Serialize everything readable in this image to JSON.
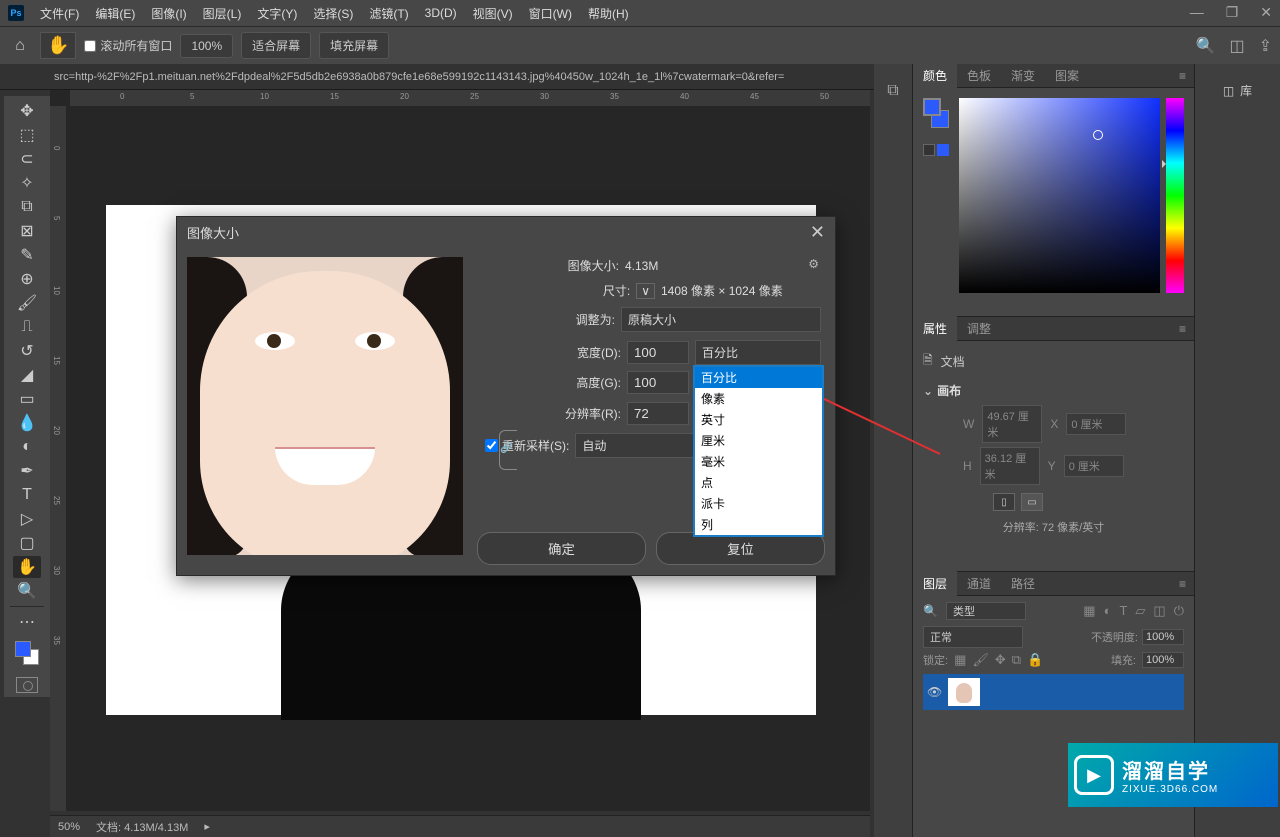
{
  "menu": {
    "items": [
      "文件(F)",
      "编辑(E)",
      "图像(I)",
      "图层(L)",
      "文字(Y)",
      "选择(S)",
      "滤镜(T)",
      "3D(D)",
      "视图(V)",
      "窗口(W)",
      "帮助(H)"
    ]
  },
  "options": {
    "scroll_all": "滚动所有窗口",
    "zoom": "100%",
    "fit_screen": "适合屏幕",
    "fill_screen": "填充屏幕"
  },
  "doc_tab": "src=http-%2F%2Fp1.meituan.net%2Fdpdeal%2F5d5db2e6938a0b879cfe1e68e599192c1143143.jpg%40450w_1024h_1e_1l%7cwatermark=0&refer=",
  "ruler_h": [
    "0",
    "5",
    "10",
    "15",
    "20",
    "25",
    "30",
    "35",
    "40",
    "45",
    "50"
  ],
  "ruler_v": [
    "0",
    "5",
    "10",
    "15",
    "20",
    "25",
    "30",
    "35"
  ],
  "dialog": {
    "title": "图像大小",
    "size_label": "图像大小:",
    "size_val": "4.13M",
    "dim_label": "尺寸:",
    "dim_val": "1408 像素 × 1024 像素",
    "fit_label": "调整为:",
    "fit_val": "原稿大小",
    "width_label": "宽度(D):",
    "width_val": "100",
    "height_label": "高度(G):",
    "height_val": "100",
    "res_label": "分辨率(R):",
    "res_val": "72",
    "unit_sel": "百分比",
    "resample_label": "重新采样(S):",
    "resample_val": "自动",
    "ok": "确定",
    "cancel": "复位"
  },
  "dropdown_options": [
    "百分比",
    "像素",
    "英寸",
    "厘米",
    "毫米",
    "点",
    "派卡",
    "列"
  ],
  "panels": {
    "color_tabs": [
      "颜色",
      "色板",
      "渐变",
      "图案"
    ],
    "lib": "库",
    "props_tabs": [
      "属性",
      "调整"
    ],
    "props_doc": "文档",
    "props_canvas": "画布",
    "props_w": "W",
    "props_w_val": "49.67 厘米",
    "props_x": "X",
    "props_x_val": "0 厘米",
    "props_h": "H",
    "props_h_val": "36.12 厘米",
    "props_y": "Y",
    "props_y_val": "0 厘米",
    "props_res": "分辨率: 72 像素/英寸",
    "layers_tabs": [
      "图层",
      "通道",
      "路径"
    ],
    "layer_kind": "类型",
    "layer_blend": "正常",
    "layer_opacity_label": "不透明度:",
    "layer_opacity": "100%",
    "layer_lock_label": "锁定:",
    "layer_fill_label": "填充:",
    "layer_fill": "100%"
  },
  "watermark": {
    "title": "溜溜自学",
    "sub": "ZIXUE.3D66.COM"
  },
  "status": {
    "zoom": "50%",
    "doc": "文档: 4.13M/4.13M"
  }
}
